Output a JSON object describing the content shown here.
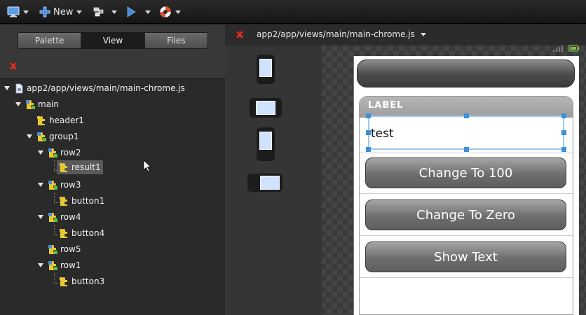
{
  "toolbar": {
    "new_label": "New"
  },
  "left_panel": {
    "tabs": [
      {
        "label": "Palette",
        "active": false
      },
      {
        "label": "View",
        "active": true
      },
      {
        "label": "Files",
        "active": false
      }
    ]
  },
  "tree": {
    "root": "app2/app/views/main/main-chrome.js",
    "main": "main",
    "header1": "header1",
    "group1": "group1",
    "row2": "row2",
    "result1": "result1",
    "row3": "row3",
    "button1": "button1",
    "row4": "row4",
    "button4": "button4",
    "row5": "row5",
    "row1": "row1",
    "button3": "button3"
  },
  "editor": {
    "file_tab": "app2/app/views/main/main-chrome.js"
  },
  "preview": {
    "panel_label": "LABEL",
    "field_value": "test",
    "buttons": [
      "Change To 100",
      "Change To Zero",
      "Show Text"
    ]
  },
  "colors": {
    "selection_handle": "#3d8fd6",
    "field_border": "#9fc7e8"
  }
}
